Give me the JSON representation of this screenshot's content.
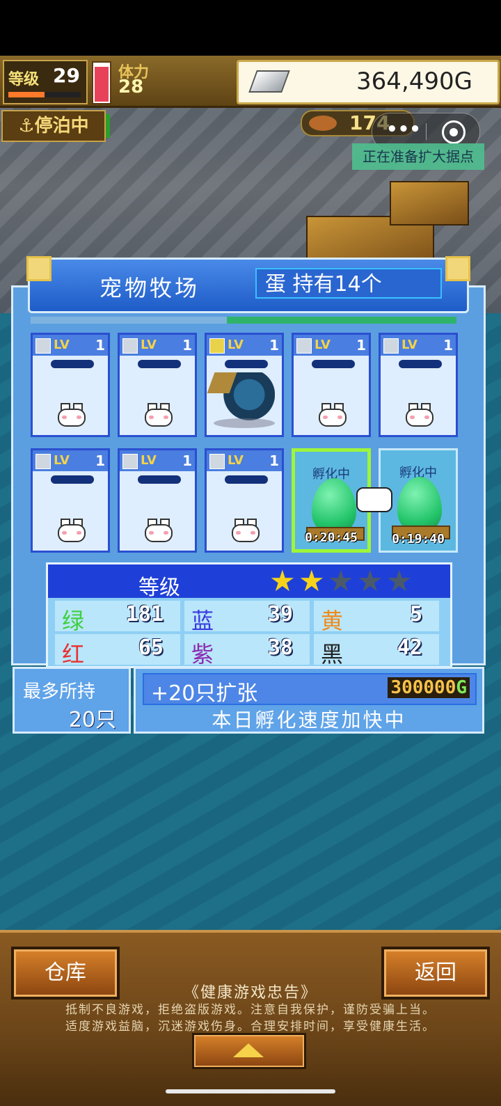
{
  "hud": {
    "level_label": "等级",
    "level_value": "29",
    "level_progress": 0.5,
    "stamina_label": "体力",
    "stamina_value": "28",
    "gold": "364,490G"
  },
  "status": {
    "dock_label": "停泊中",
    "resource_value": "174",
    "notice": "正在准备扩大据点"
  },
  "panel": {
    "title": "宠物牧场",
    "eggs_label": "蛋 持有14个"
  },
  "slots": [
    {
      "type": "pet",
      "lv_label": "LV",
      "lv": "1"
    },
    {
      "type": "pet",
      "lv_label": "LV",
      "lv": "1"
    },
    {
      "type": "dragon",
      "lv_label": "LV",
      "lv": "1"
    },
    {
      "type": "pet",
      "lv_label": "LV",
      "lv": "1"
    },
    {
      "type": "pet",
      "lv_label": "LV",
      "lv": "1"
    },
    {
      "type": "pet",
      "lv_label": "LV",
      "lv": "1"
    },
    {
      "type": "pet",
      "lv_label": "LV",
      "lv": "1"
    },
    {
      "type": "pet",
      "lv_label": "LV",
      "lv": "1"
    },
    {
      "type": "egg",
      "label": "孵化中",
      "timer": "0:20:45",
      "selected": true
    },
    {
      "type": "egg",
      "label": "孵化中",
      "timer": "0:19:40",
      "selected": false
    }
  ],
  "stats": {
    "grade_label": "等级",
    "stars_filled": 2,
    "stars_total": 5,
    "rows": [
      [
        {
          "k": "绿",
          "v": "181",
          "c": "#3ecf3e"
        },
        {
          "k": "蓝",
          "v": "39",
          "c": "#3a3ae0"
        },
        {
          "k": "黄",
          "v": "5",
          "c": "#f08a1a"
        }
      ],
      [
        {
          "k": "红",
          "v": "65",
          "c": "#e83030"
        },
        {
          "k": "紫",
          "v": "38",
          "c": "#8a2ab0"
        },
        {
          "k": "黑",
          "v": "42",
          "c": "#222222"
        }
      ]
    ]
  },
  "capacity": {
    "label": "最多所持",
    "value": "20只"
  },
  "expand": {
    "label": "+20只扩张",
    "price": "300000",
    "price_unit": "G",
    "speed_notice": "本日孵化速度加快中"
  },
  "bottom": {
    "warehouse": "仓库",
    "back": "返回",
    "health_title": "《健康游戏忠告》",
    "health_line1": "抵制不良游戏，拒绝盗版游戏。注意自我保护，谨防受骗上当。",
    "health_line2": "适度游戏益脑，沉迷游戏伤身。合理安排时间，享受健康生活。"
  },
  "colors": {
    "panel": "#5b9fe0",
    "egg": "#23c46a",
    "select_border": "#9ef53a",
    "star_on": "#f6d21a",
    "star_off": "#4a5a6a"
  }
}
